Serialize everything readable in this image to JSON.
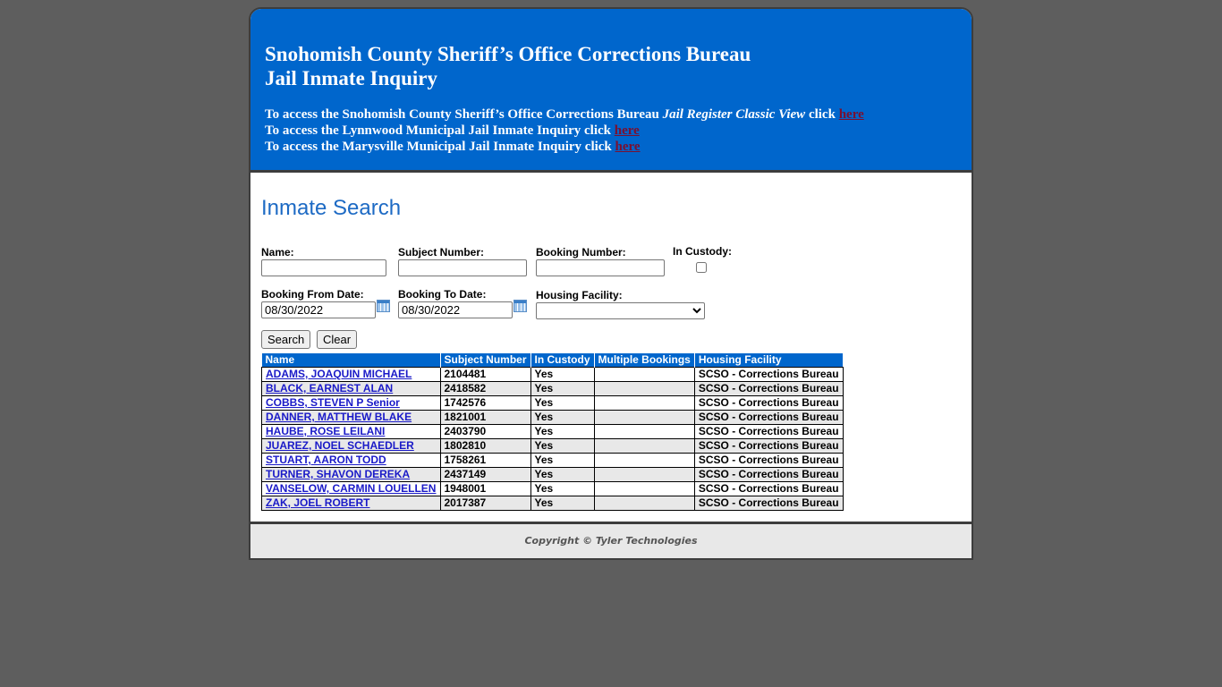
{
  "header": {
    "title_line1": "Snohomish County Sheriff’s Office Corrections Bureau",
    "title_line2": "Jail Inmate Inquiry",
    "links": [
      {
        "prefix": "To access the Snohomish County Sheriff’s Office Corrections Bureau ",
        "italic": "Jail Register Classic View",
        "suffix": " click ",
        "link_text": "here"
      },
      {
        "prefix": "To access the Lynnwood Municipal Jail Inmate Inquiry click ",
        "italic": "",
        "suffix": "",
        "link_text": "here"
      },
      {
        "prefix": "To access the Marysville Municipal Jail Inmate Inquiry click ",
        "italic": "",
        "suffix": "",
        "link_text": "here"
      }
    ]
  },
  "search": {
    "title": "Inmate Search",
    "name_label": "Name:",
    "name_value": "",
    "subject_label": "Subject Number:",
    "subject_value": "",
    "booking_label": "Booking Number:",
    "booking_value": "",
    "custody_label": "In Custody:",
    "custody_checked": false,
    "from_label": "Booking From Date:",
    "from_value": "08/30/2022",
    "to_label": "Booking To Date:",
    "to_value": "08/30/2022",
    "facility_label": "Housing Facility:",
    "facility_selected": "",
    "search_button": "Search",
    "clear_button": "Clear"
  },
  "results": {
    "columns": [
      "Name",
      "Subject Number",
      "In Custody",
      "Multiple Bookings",
      "Housing Facility"
    ],
    "rows": [
      {
        "name": "ADAMS, JOAQUIN MICHAEL",
        "subject": "2104481",
        "custody": "Yes",
        "multiple": "",
        "facility": "SCSO - Corrections Bureau"
      },
      {
        "name": "BLACK, EARNEST ALAN",
        "subject": "2418582",
        "custody": "Yes",
        "multiple": "",
        "facility": "SCSO - Corrections Bureau"
      },
      {
        "name": "COBBS, STEVEN P Senior",
        "subject": "1742576",
        "custody": "Yes",
        "multiple": "",
        "facility": "SCSO - Corrections Bureau"
      },
      {
        "name": "DANNER, MATTHEW BLAKE",
        "subject": "1821001",
        "custody": "Yes",
        "multiple": "",
        "facility": "SCSO - Corrections Bureau"
      },
      {
        "name": "HAUBE, ROSE LEILANI",
        "subject": "2403790",
        "custody": "Yes",
        "multiple": "",
        "facility": "SCSO - Corrections Bureau"
      },
      {
        "name": "JUAREZ, NOEL SCHAEDLER",
        "subject": "1802810",
        "custody": "Yes",
        "multiple": "",
        "facility": "SCSO - Corrections Bureau"
      },
      {
        "name": "STUART, AARON TODD",
        "subject": "1758261",
        "custody": "Yes",
        "multiple": "",
        "facility": "SCSO - Corrections Bureau"
      },
      {
        "name": "TURNER, SHAVON DEREKA",
        "subject": "2437149",
        "custody": "Yes",
        "multiple": "",
        "facility": "SCSO - Corrections Bureau"
      },
      {
        "name": "VANSELOW, CARMIN LOUELLEN",
        "subject": "1948001",
        "custody": "Yes",
        "multiple": "",
        "facility": "SCSO - Corrections Bureau"
      },
      {
        "name": "ZAK, JOEL ROBERT",
        "subject": "2017387",
        "custody": "Yes",
        "multiple": "",
        "facility": "SCSO - Corrections Bureau"
      }
    ]
  },
  "footer": {
    "copyright": "Copyright © Tyler Technologies"
  },
  "colors": {
    "header_blue": "#0066cc",
    "link_maroon": "#7a1030",
    "title_blue": "#1d6ac4",
    "row_alt": "#e8e8e8",
    "background": "#5e5e5e"
  }
}
